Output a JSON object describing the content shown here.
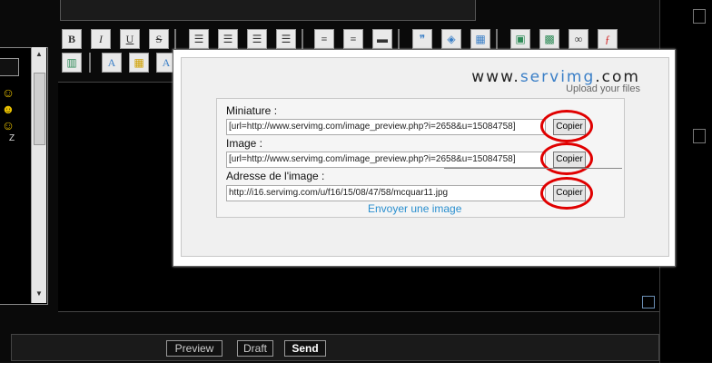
{
  "toolbar": {
    "buttons": [
      "bold-icon",
      "italic-icon",
      "underline-icon",
      "strike-icon",
      "align-left-icon",
      "align-center-icon",
      "align-right-icon",
      "justify-icon",
      "bullet-list-icon",
      "numbered-list-icon",
      "hr-icon",
      "quote-icon",
      "code-icon",
      "table-icon",
      "image-icon",
      "host-image-icon",
      "link-icon",
      "flash-icon",
      "video-icon",
      "font-icon",
      "color-icon",
      "font-size-icon"
    ],
    "bold_glyph": "B",
    "italic_glyph": "I",
    "underline_glyph": "U",
    "strike_glyph": "S"
  },
  "left_panel": {
    "letter": "Z"
  },
  "popup": {
    "logo": {
      "brand_prefix": "www.",
      "brand_accent": "servimg",
      "brand_suffix": ".com",
      "tagline": "Upload your files"
    },
    "thumbnail": {
      "label": "Miniature :",
      "value": "[url=http://www.servimg.com/image_preview.php?i=2658&u=15084758]",
      "copy_label": "Copier"
    },
    "image": {
      "label": "Image :",
      "value": "[url=http://www.servimg.com/image_preview.php?i=2658&u=15084758]",
      "copy_label": "Copier"
    },
    "address": {
      "label": "Adresse de l'image :",
      "value": "http://i16.servimg.com/u/f16/15/08/47/58/mcquar11.jpg",
      "copy_label": "Copier"
    },
    "upload_link": "Envoyer une image"
  },
  "bottom_bar": {
    "preview": "Preview",
    "draft": "Draft",
    "send": "Send"
  },
  "colors": {
    "highlight_circle": "#e00000",
    "link": "#2a8fcf",
    "brand_accent": "#3a7fc7"
  }
}
